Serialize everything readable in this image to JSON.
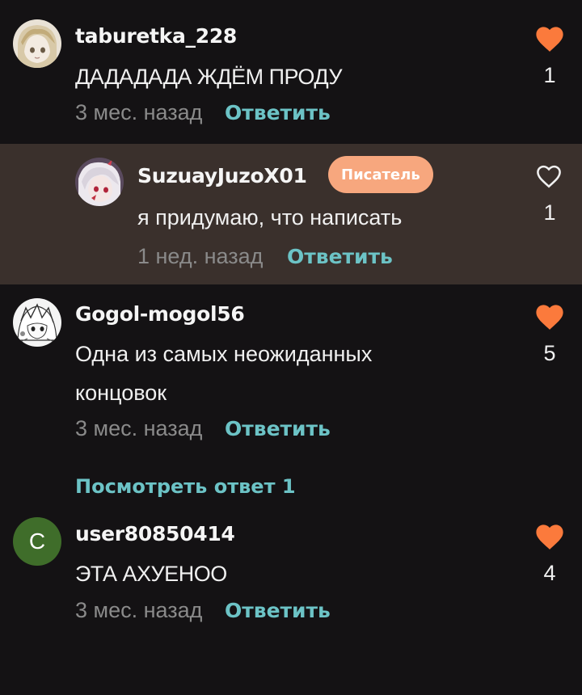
{
  "colors": {
    "background": "#141214",
    "reply_background": "#3a302c",
    "accent_teal": "#6cc3c6",
    "heart_filled": "#fb7a3c",
    "badge": "#f7a77e",
    "muted": "#8a8a8a"
  },
  "comments": [
    {
      "username": "taburetka_228",
      "text": "ДАДАДАДА ЖДЁМ ПРОДУ",
      "time": "3 мес. назад",
      "reply_label": "Ответить",
      "likes": "1",
      "liked": true,
      "avatar_icon": "anime-avatar-icon"
    },
    {
      "username": "SuzuayJuzoX01",
      "badge": "Писатель",
      "text": "я придумаю, что написать",
      "time": "1 нед. назад",
      "reply_label": "Ответить",
      "likes": "1",
      "liked": false,
      "avatar_icon": "anime-avatar-icon"
    },
    {
      "username": "Gogol-mogol56",
      "text": "Одна из самых неожиданных концовок",
      "time": "3 мес. назад",
      "reply_label": "Ответить",
      "likes": "5",
      "liked": true,
      "avatar_icon": "anime-avatar-icon",
      "view_replies_label": "Посмотреть ответ 1"
    },
    {
      "username": "user80850414",
      "avatar_letter": "C",
      "text": "ЭТА АХУЕНОО",
      "time": "3 мес. назад",
      "reply_label": "Ответить",
      "likes": "4",
      "liked": true
    }
  ]
}
